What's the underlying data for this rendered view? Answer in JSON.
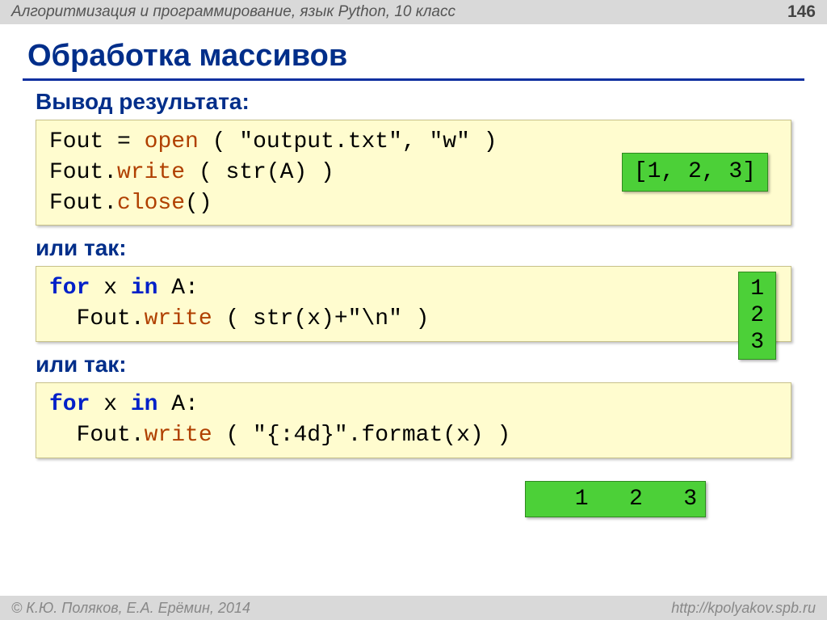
{
  "header": {
    "course": "Алгоритмизация и программирование, язык Python, 10 класс",
    "page_number": "146"
  },
  "title": "Обработка массивов",
  "subhead1": "Вывод результата:",
  "code1": {
    "l1a": "Fout",
    "l1b": " = ",
    "l1c": "open",
    "l1d": " ( \"output.txt\", \"w\" )",
    "l2a": "Fout.",
    "l2b": "write",
    "l2c": " ( str(A) )",
    "l3a": "Fout.",
    "l3b": "close",
    "l3c": "()"
  },
  "output1": "[1, 2, 3]",
  "subhead2": "или так:",
  "code2": {
    "l1a": "for",
    "l1b": " x ",
    "l1c": "in",
    "l1d": " A:",
    "l2a": "  Fout.",
    "l2b": "write",
    "l2c": " ( str(x)+\"\\n\" )"
  },
  "output2": "1\n2\n3",
  "subhead3": "или так:",
  "code3": {
    "l1a": "for",
    "l1b": " x ",
    "l1c": "in",
    "l1d": " A:",
    "l2a": "  Fout.",
    "l2b": "write",
    "l2c": " ( \"{:4d}\".format(x) )"
  },
  "output3": "   1   2   3",
  "footer": {
    "copyright": "© К.Ю. Поляков, Е.А. Ерёмин, 2014",
    "url": "http://kpolyakov.spb.ru"
  }
}
